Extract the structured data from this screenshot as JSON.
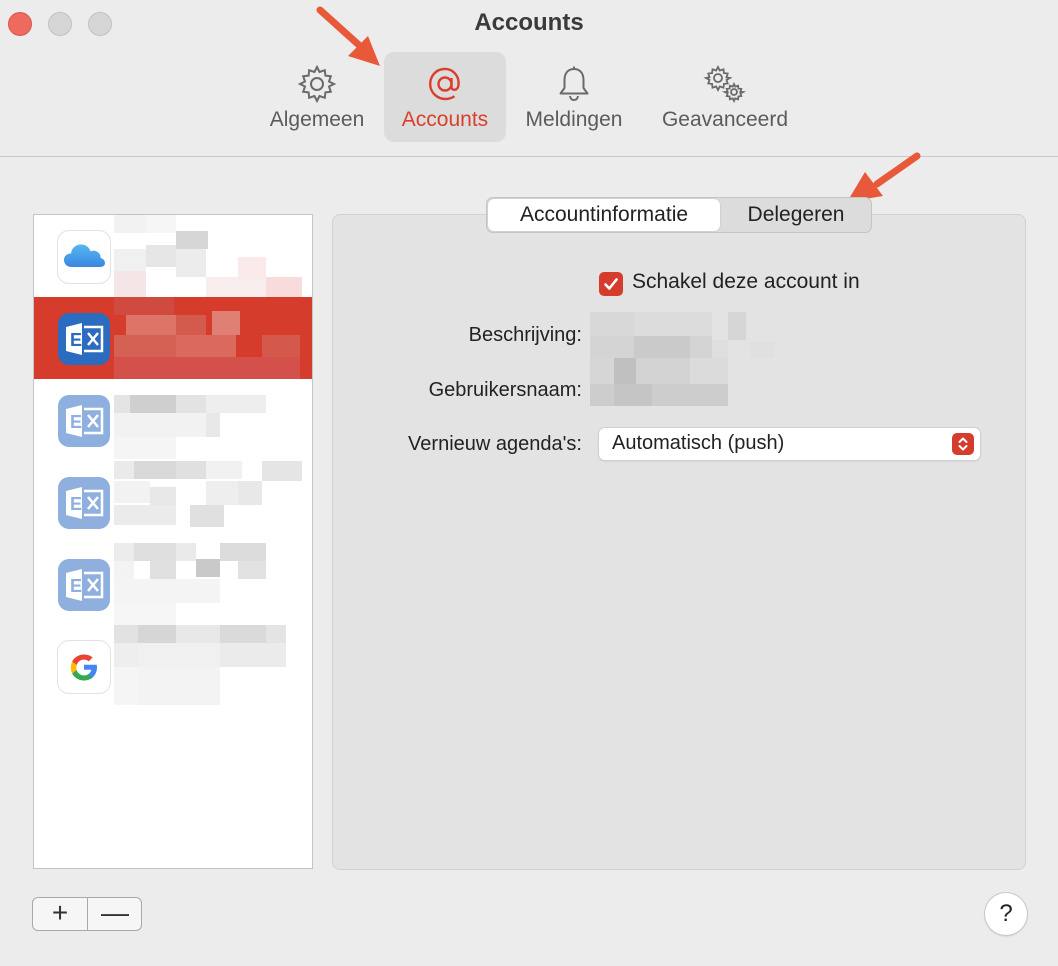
{
  "window": {
    "title": "Accounts"
  },
  "toolbar": {
    "tabs": [
      {
        "label": "Algemeen",
        "icon": "gear-icon",
        "selected": false
      },
      {
        "label": "Accounts",
        "icon": "at-sign-icon",
        "selected": true
      },
      {
        "label": "Meldingen",
        "icon": "bell-icon",
        "selected": false
      },
      {
        "label": "Geavanceerd",
        "icon": "gears-icon",
        "selected": false
      }
    ]
  },
  "sidebar": {
    "accounts": [
      {
        "type": "iCloud",
        "icon": "icloud-icon",
        "selected": false,
        "name_redacted": true
      },
      {
        "type": "Exchange",
        "icon": "exchange-icon",
        "selected": true,
        "name_redacted": true
      },
      {
        "type": "Exchange",
        "icon": "exchange-icon",
        "selected": false,
        "name_redacted": true
      },
      {
        "type": "Exchange",
        "icon": "exchange-icon",
        "selected": false,
        "name_redacted": true
      },
      {
        "type": "Exchange",
        "icon": "exchange-icon",
        "selected": false,
        "name_redacted": true
      },
      {
        "type": "Google",
        "icon": "google-icon",
        "selected": false,
        "name_redacted": true
      }
    ],
    "add_label": "+",
    "remove_label": "—"
  },
  "detail": {
    "segments": {
      "info_label": "Accountinformatie",
      "delegate_label": "Delegeren",
      "active": "Accountinformatie"
    },
    "enable_label": "Schakel deze account in",
    "enable_checked": true,
    "description_label": "Beschrijving:",
    "username_label": "Gebruikersnaam:",
    "refresh_label": "Vernieuw agenda's:",
    "refresh_value": "Automatisch (push)"
  },
  "help_label": "?",
  "colors": {
    "accent": "#d63c2c",
    "annotation_arrow": "#e8593a",
    "background": "#ececec"
  }
}
